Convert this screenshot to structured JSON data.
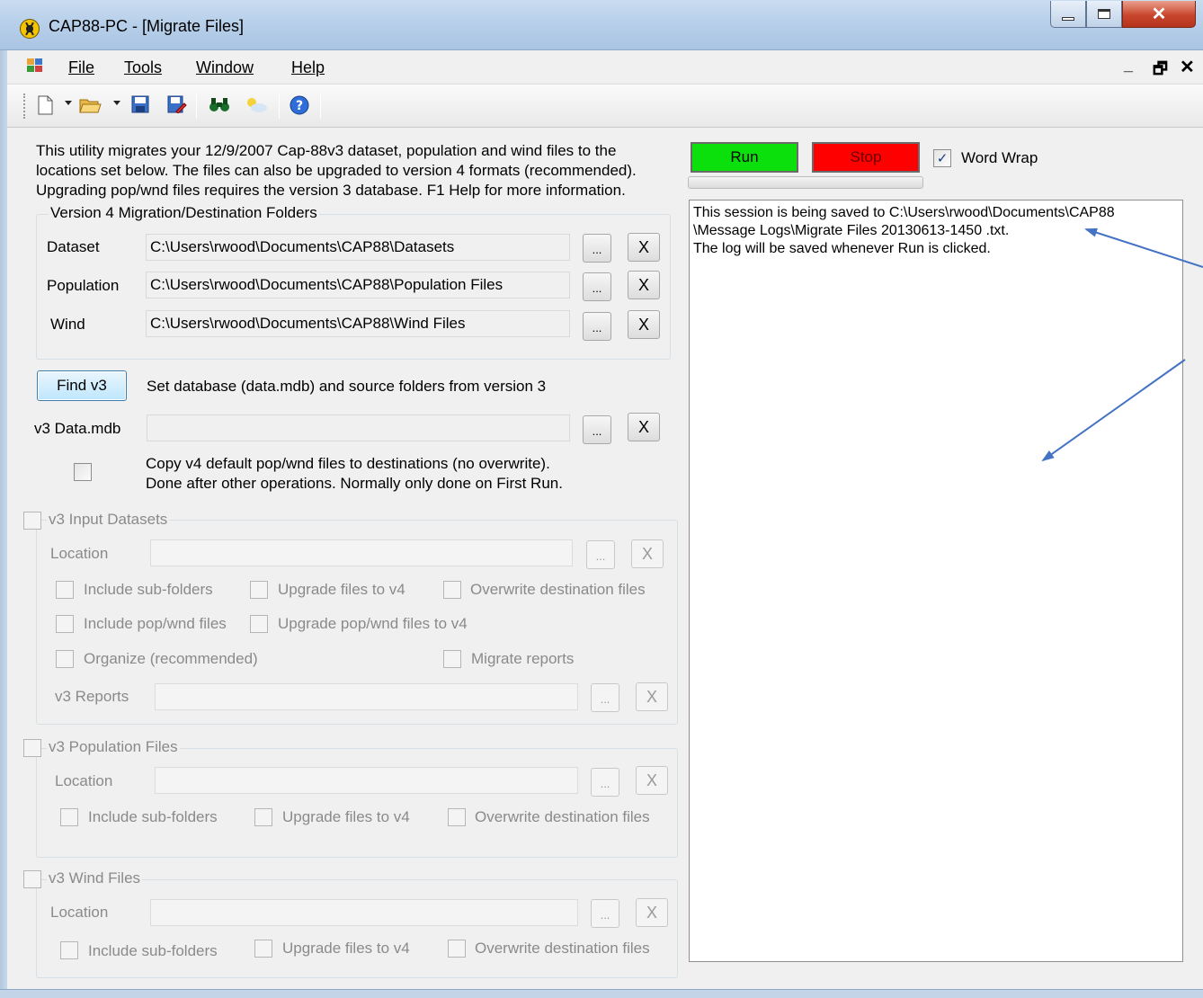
{
  "window": {
    "title": "CAP88-PC - [Migrate Files]"
  },
  "menu": [
    "File",
    "Tools",
    "Window",
    "Help"
  ],
  "toolbar_icons": [
    "new-file-icon",
    "open-folder-icon",
    "save-icon",
    "save-as-icon",
    "find-icon",
    "weather-icon",
    "help-icon"
  ],
  "intro": [
    "This utility migrates your 12/9/2007 Cap-88v3 dataset, population and wind files to the",
    "locations set below.  The files can also be upgraded to version 4 formats (recommended).",
    "Upgrading pop/wnd files requires the version 3 database.  F1 Help for more information."
  ],
  "v4_group": {
    "label": "Version 4 Migration/Destination Folders",
    "rows": [
      {
        "label": "Dataset",
        "value": "C:\\Users\\rwood\\Documents\\CAP88\\Datasets"
      },
      {
        "label": "Population",
        "value": "C:\\Users\\rwood\\Documents\\CAP88\\Population Files"
      },
      {
        "label": "Wind",
        "value": "C:\\Users\\rwood\\Documents\\CAP88\\Wind Files"
      }
    ],
    "browse_label": "...",
    "clear_label": "X"
  },
  "find_v3": {
    "button": "Find v3",
    "description": "Set database (data.mdb) and source folders from version 3",
    "data_mdb_label": "v3 Data.mdb",
    "data_mdb_value": ""
  },
  "copy_defaults": {
    "checked": false,
    "line1": "Copy v4 default pop/wnd files to destinations (no overwrite).",
    "line2": "Done after other operations.  Normally only done on First Run."
  },
  "v3_input": {
    "label": "v3 Input Datasets",
    "location_label": "Location",
    "options": {
      "include_subfolders": "Include sub-folders",
      "upgrade_v4": "Upgrade files to v4",
      "overwrite": "Overwrite destination files",
      "include_popwnd": "Include pop/wnd files",
      "upgrade_popwnd": "Upgrade pop/wnd files to v4",
      "organize": "Organize (recommended)",
      "migrate_reports": "Migrate reports"
    },
    "reports_label": "v3 Reports"
  },
  "v3_population": {
    "label": "v3 Population Files",
    "location_label": "Location",
    "options": {
      "include_subfolders": "Include sub-folders",
      "upgrade_v4": "Upgrade files to v4",
      "overwrite": "Overwrite destination files"
    }
  },
  "v3_wind": {
    "label": "v3 Wind Files",
    "location_label": "Location",
    "options": {
      "include_subfolders": "Include sub-folders",
      "upgrade_v4": "Upgrade files to v4",
      "overwrite": "Overwrite destination files"
    }
  },
  "controls": {
    "run": "Run",
    "stop": "Stop",
    "word_wrap": "Word Wrap",
    "word_wrap_checked": true,
    "run_color": "#0ce00c",
    "stop_color": "#ff0000"
  },
  "log": [
    "This session is being saved to C:\\Users\\rwood\\Documents\\CAP88",
    "\\Message Logs\\Migrate Files 20130613-1450 .txt.",
    "The log will be saved whenever Run is clicked."
  ],
  "annotation_color": "#4472c4"
}
